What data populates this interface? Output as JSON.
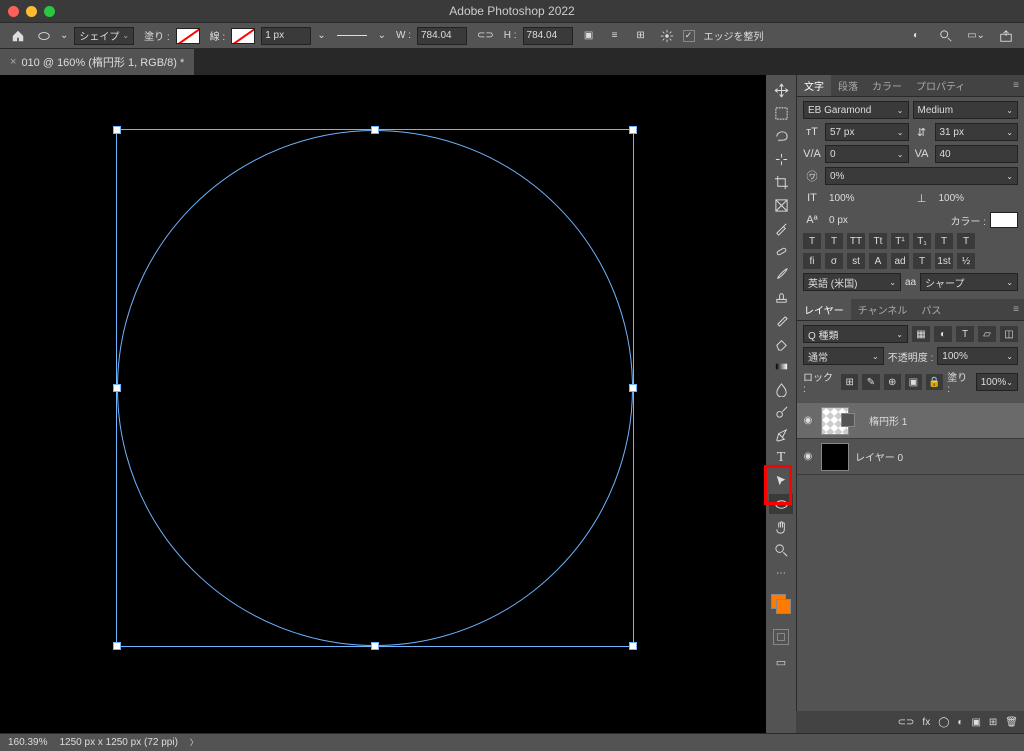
{
  "app": {
    "title": "Adobe Photoshop 2022"
  },
  "document_tab": "010 @ 160% (楕円形 1, RGB/8) *",
  "options_bar": {
    "mode": "シェイプ",
    "fill_label": "塗り :",
    "stroke_label": "線 :",
    "stroke_weight": "1 px",
    "w_label": "W :",
    "w": "784.04",
    "link_label": "⊂⊃",
    "h_label": "H :",
    "h": "784.04",
    "align_edges_checked": true,
    "align_edges_label": "エッジを整列"
  },
  "character": {
    "tabs": [
      "文字",
      "段落",
      "カラー",
      "プロパティ"
    ],
    "font_family": "EB Garamond",
    "font_style": "Medium",
    "font_size": "57 px",
    "leading": "31 px",
    "kerning_mode": "VA",
    "kerning": "0",
    "tracking_label": "VA",
    "tracking": "40",
    "tsume": "0%",
    "h_scale": "100%",
    "v_scale": "100%",
    "baseline": "0 px",
    "color_label": "カラー :",
    "style_row1": [
      "T",
      "T",
      "TT",
      "Tt",
      "T¹",
      "T₁",
      "T",
      "T"
    ],
    "style_row2": [
      "fi",
      "σ",
      "st",
      "A",
      "ad",
      "T",
      "1st",
      "½"
    ],
    "lang": "英語 (米国)",
    "aa_label": "aa",
    "aa": "シャープ"
  },
  "layers": {
    "tabs": [
      "レイヤー",
      "チャンネル",
      "パス"
    ],
    "filter": "Q 種類",
    "blend_mode": "通常",
    "opacity_label": "不透明度 :",
    "opacity": "100%",
    "lock_label": "ロック :",
    "fill_label": "塗り :",
    "fill": "100%",
    "items": [
      {
        "name": "楕円形 1"
      },
      {
        "name": "レイヤー 0"
      }
    ]
  },
  "status": {
    "zoom": "160.39%",
    "info": "1250 px x 1250 px (72 ppi)"
  },
  "tools": [
    "move",
    "marquee",
    "lasso",
    "wand",
    "crop",
    "frame",
    "eyedropper",
    "heal",
    "brush",
    "stamp",
    "history-brush",
    "eraser",
    "gradient",
    "blur",
    "dodge",
    "pen",
    "type",
    "path-select",
    "ellipse",
    "hand",
    "zoom"
  ]
}
